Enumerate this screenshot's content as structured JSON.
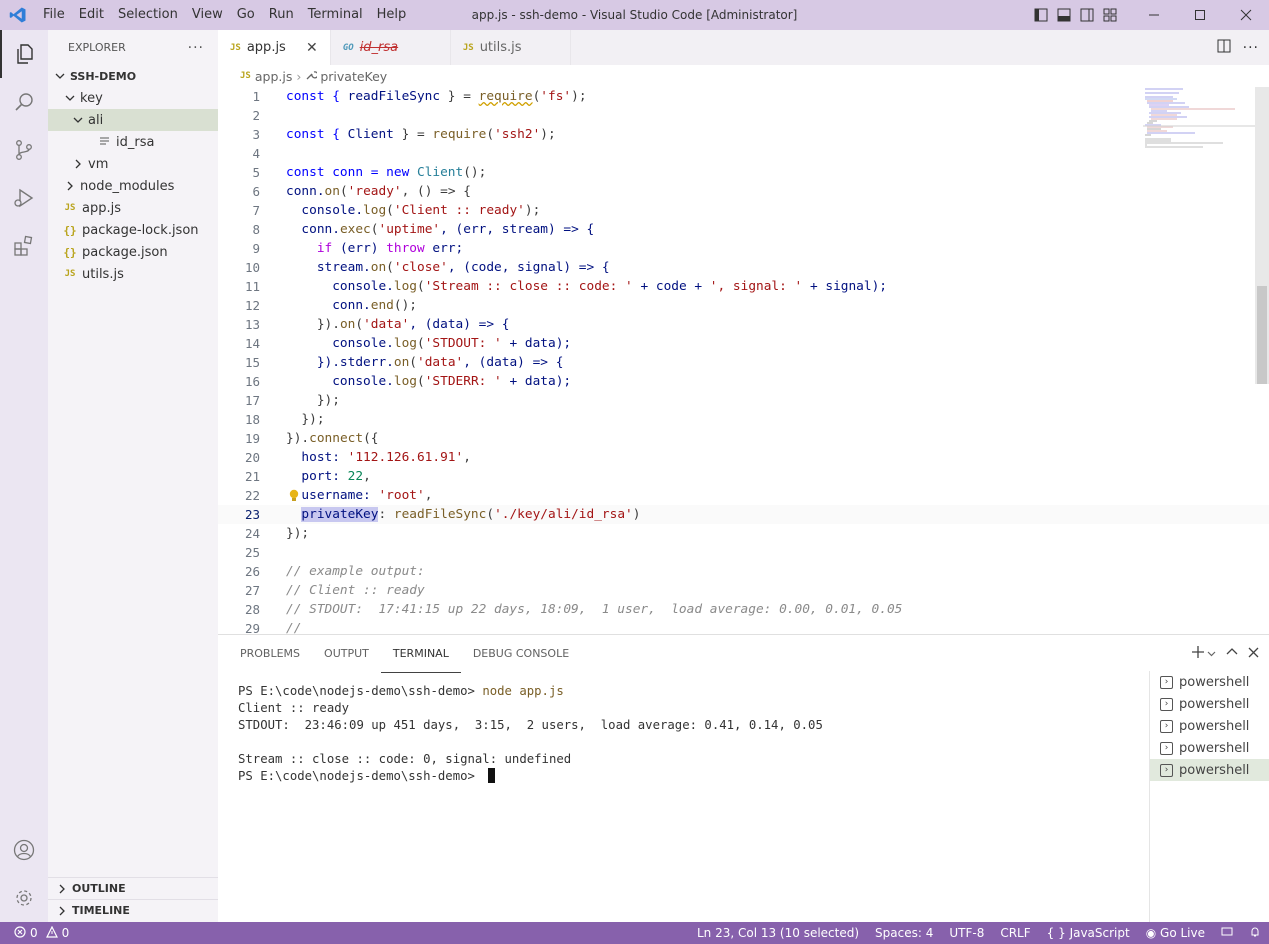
{
  "window": {
    "title": "app.js - ssh-demo - Visual Studio Code [Administrator]"
  },
  "menu": [
    "File",
    "Edit",
    "Selection",
    "View",
    "Go",
    "Run",
    "Terminal",
    "Help"
  ],
  "sidebar": {
    "header": "EXPLORER",
    "project": "SSH-DEMO",
    "tree": [
      {
        "label": "key",
        "kind": "folder-open",
        "depth": 1
      },
      {
        "label": "ali",
        "kind": "folder-open",
        "depth": 2,
        "selected": true
      },
      {
        "label": "id_rsa",
        "kind": "file-text",
        "depth": 3
      },
      {
        "label": "vm",
        "kind": "folder-closed",
        "depth": 2
      },
      {
        "label": "node_modules",
        "kind": "folder-closed",
        "depth": 1
      },
      {
        "label": "app.js",
        "kind": "js",
        "depth": 1
      },
      {
        "label": "package-lock.json",
        "kind": "json",
        "depth": 1
      },
      {
        "label": "package.json",
        "kind": "json",
        "depth": 1
      },
      {
        "label": "utils.js",
        "kind": "js",
        "depth": 1
      }
    ],
    "outline_label": "OUTLINE",
    "timeline_label": "TIMELINE"
  },
  "tabs": [
    {
      "label": "app.js",
      "icon": "JS",
      "active": true
    },
    {
      "label": "id_rsa",
      "icon": "GO",
      "strike": true
    },
    {
      "label": "utils.js",
      "icon": "JS"
    }
  ],
  "breadcrumb": {
    "file": "app.js",
    "file_icon": "JS",
    "symbol": "privateKey"
  },
  "code": {
    "current_line": 23,
    "lines": [
      "1",
      "2",
      "3",
      "4",
      "5",
      "6",
      "7",
      "8",
      "9",
      "10",
      "11",
      "12",
      "13",
      "14",
      "15",
      "16",
      "17",
      "18",
      "19",
      "20",
      "21",
      "22",
      "23",
      "24",
      "25",
      "26",
      "27",
      "28",
      "29"
    ],
    "text": {
      "l1_a": "const { ",
      "l1_b": "readFileSync",
      "l1_c": " } = ",
      "l1_d": "require",
      "l1_e": "(",
      "l1_f": "'fs'",
      "l1_g": ");",
      "l3_a": "const { ",
      "l3_b": "Client",
      "l3_c": " } = ",
      "l3_d": "require",
      "l3_e": "(",
      "l3_f": "'ssh2'",
      "l3_g": ");",
      "l5_a": "const conn = new ",
      "l5_b": "Client",
      "l5_c": "();",
      "l6_a": "conn.",
      "l6_b": "on",
      "l6_c": "(",
      "l6_d": "'ready'",
      "l6_e": ", () => {",
      "l7_a": "  console.",
      "l7_b": "log",
      "l7_c": "(",
      "l7_d": "'Client :: ready'",
      "l7_e": ");",
      "l8_a": "  conn.",
      "l8_b": "exec",
      "l8_c": "(",
      "l8_d": "'uptime'",
      "l8_e": ", (err, stream) => {",
      "l9_a": "    ",
      "l9_b": "if",
      "l9_c": " (err) ",
      "l9_d": "throw",
      "l9_e": " err;",
      "l10_a": "    stream.",
      "l10_b": "on",
      "l10_c": "(",
      "l10_d": "'close'",
      "l10_e": ", (code, signal) => {",
      "l11_a": "      console.",
      "l11_b": "log",
      "l11_c": "(",
      "l11_d": "'Stream :: close :: code: '",
      "l11_e": " + code + ",
      "l11_f": "', signal: '",
      "l11_g": " + signal);",
      "l12_a": "      conn.",
      "l12_b": "end",
      "l12_c": "();",
      "l13_a": "    }).",
      "l13_b": "on",
      "l13_c": "(",
      "l13_d": "'data'",
      "l13_e": ", (data) => {",
      "l14_a": "      console.",
      "l14_b": "log",
      "l14_c": "(",
      "l14_d": "'STDOUT: '",
      "l14_e": " + data);",
      "l15_a": "    }).stderr.",
      "l15_b": "on",
      "l15_c": "(",
      "l15_d": "'data'",
      "l15_e": ", (data) => {",
      "l16_a": "      console.",
      "l16_b": "log",
      "l16_c": "(",
      "l16_d": "'STDERR: '",
      "l16_e": " + data);",
      "l17": "    });",
      "l18": "  });",
      "l19_a": "}).",
      "l19_b": "connect",
      "l19_c": "({",
      "l20_a": "  host: ",
      "l20_b": "'112.126.61.91'",
      "l20_c": ",",
      "l21_a": "  port: ",
      "l21_b": "22",
      "l21_c": ",",
      "l22_a": "  username: ",
      "l22_b": "'root'",
      "l22_c": ",",
      "l23_a": "  ",
      "l23_b": "privateKey",
      "l23_c": ": ",
      "l23_d": "readFileSync",
      "l23_e": "(",
      "l23_f": "'./key/ali/id_rsa'",
      "l23_g": ")",
      "l24": "});",
      "l26": "// example output:",
      "l27": "// Client :: ready",
      "l28": "// STDOUT:  17:41:15 up 22 days, 18:09,  1 user,  load average: 0.00, 0.01, 0.05",
      "l29": "//"
    }
  },
  "panel": {
    "tabs": [
      "PROBLEMS",
      "OUTPUT",
      "TERMINAL",
      "DEBUG CONSOLE"
    ],
    "active_tab": "TERMINAL",
    "terminal": {
      "prompt": "PS E:\\code\\nodejs-demo\\ssh-demo> ",
      "command": "node app.js",
      "out1": "Client :: ready",
      "out2": "STDOUT:  23:46:09 up 451 days,  3:15,  2 users,  load average: 0.41, 0.14, 0.05",
      "out3": "Stream :: close :: code: 0, signal: undefined",
      "prompt2": "PS E:\\code\\nodejs-demo\\ssh-demo> "
    },
    "terminals": [
      "powershell",
      "powershell",
      "powershell",
      "powershell",
      "powershell"
    ],
    "selected_terminal": 4
  },
  "statusbar": {
    "errors": "0",
    "warnings": "0",
    "position": "Ln 23, Col 13 (10 selected)",
    "spaces": "Spaces: 4",
    "encoding": "UTF-8",
    "eol": "CRLF",
    "language_icon": "{ }",
    "language": "JavaScript",
    "golive": "Go Live"
  },
  "colors": {
    "titlebar": "#d7c9e4",
    "activitybar": "#ebe6f2",
    "statusbar": "#8761ac",
    "selection": "#d9e0d2"
  }
}
